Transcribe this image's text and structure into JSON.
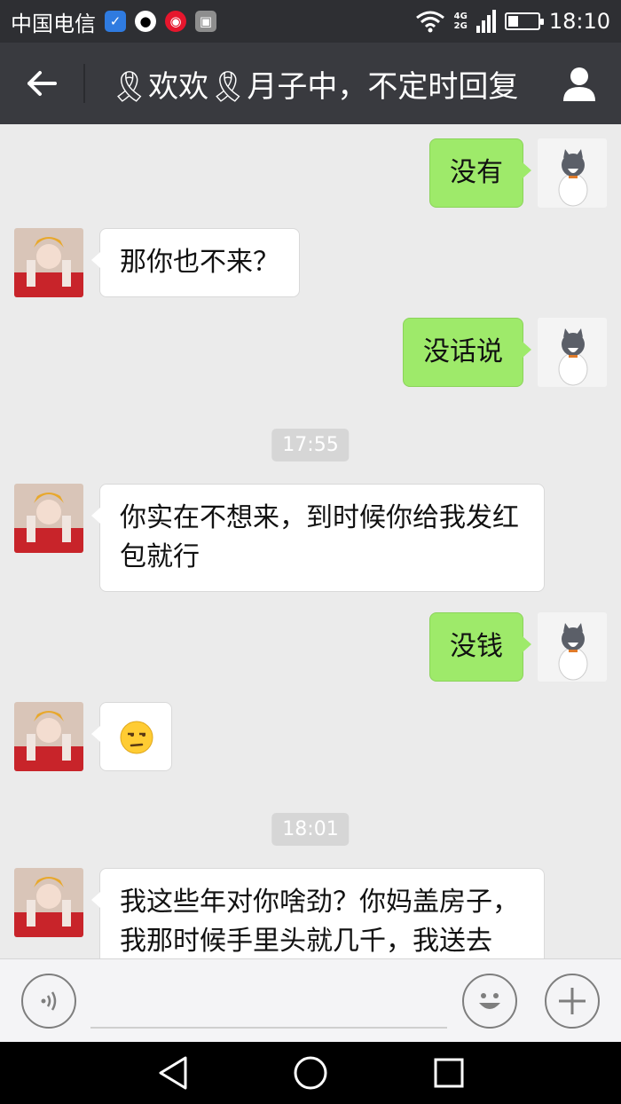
{
  "status_bar": {
    "carrier": "中国电信",
    "network_top": "4G",
    "network_bottom": "2G",
    "battery_level": 0.35,
    "time": "18:10"
  },
  "header": {
    "title": "🎗欢欢🎗月子中，不定时回复"
  },
  "messages": [
    {
      "direction": "out",
      "text": "没有"
    },
    {
      "direction": "in",
      "text": "那你也不来？"
    },
    {
      "direction": "out",
      "text": "没话说"
    },
    {
      "type": "time",
      "text": "17:55"
    },
    {
      "direction": "in",
      "text": "你实在不想来，到时候你给我发红\n包就行"
    },
    {
      "direction": "out",
      "text": "没钱"
    },
    {
      "direction": "in",
      "text": "😒"
    },
    {
      "type": "time",
      "text": "18:01"
    },
    {
      "direction": "in",
      "text": "我这些年对你啥劲？你妈盖房子，\n我那时候手里头就几千，我送去"
    }
  ],
  "colors": {
    "outgoing_bubble": "#9eea6a",
    "incoming_bubble": "#ffffff",
    "header_bg": "#393a3f",
    "chat_bg": "#ebebeb"
  },
  "icons": {
    "back": "back-arrow-icon",
    "profile": "person-icon",
    "voice": "voice-icon",
    "emoji": "emoji-icon",
    "more": "plus-icon"
  }
}
